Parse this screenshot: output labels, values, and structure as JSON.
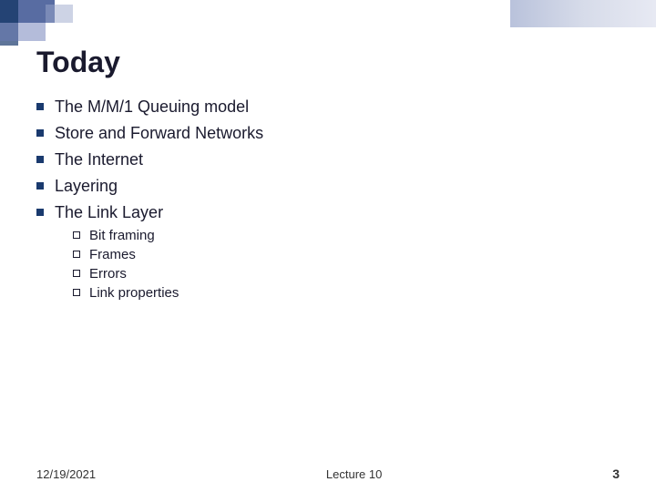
{
  "title": "Today",
  "bullets": [
    {
      "text": "The M/M/1 Queuing model",
      "subbullets": []
    },
    {
      "text": "Store and Forward Networks",
      "subbullets": []
    },
    {
      "text": "The Internet",
      "subbullets": []
    },
    {
      "text": "Layering",
      "subbullets": []
    },
    {
      "text": "The Link Layer",
      "subbullets": [
        "Bit framing",
        "Frames",
        "Errors",
        "Link properties"
      ]
    }
  ],
  "footer": {
    "date": "12/19/2021",
    "lecture": "Lecture 10",
    "page": "3"
  }
}
